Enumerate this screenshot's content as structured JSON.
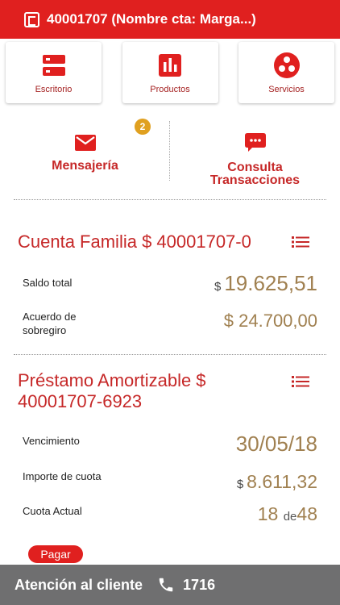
{
  "header": {
    "title": "40001707 (Nombre cta: Marga...)",
    "icon": "bank-logo-icon",
    "bg_color": "#e0201f"
  },
  "tiles": [
    {
      "label": "Escritorio",
      "icon": "desktop-icon"
    },
    {
      "label": "Productos",
      "icon": "bar-chart-icon"
    },
    {
      "label": "Servicios",
      "icon": "services-icon"
    }
  ],
  "shortcuts": {
    "messaging": {
      "label": "Mensajería",
      "icon": "envelope-icon",
      "badge": "2"
    },
    "transactions": {
      "label": "Consulta Transacciones",
      "icon": "chat-bubble-icon"
    }
  },
  "account": {
    "title": "Cuenta Familia $ 40001707-0",
    "menu_icon": "list-menu-icon",
    "rows": [
      {
        "label": "Saldo total",
        "currency": "$",
        "amount": "19.625,51"
      },
      {
        "label": "Acuerdo de sobregiro",
        "currency": "$",
        "amount": "24.700,00"
      }
    ]
  },
  "loan": {
    "title": "Préstamo Amortizable $ 40001707-6923",
    "menu_icon": "list-menu-icon",
    "rows": [
      {
        "label": "Vencimiento",
        "value": "30/05/18"
      },
      {
        "label": "Importe de cuota",
        "currency": "$",
        "amount": "8.611,32"
      },
      {
        "label": "Cuota Actual",
        "current": "18",
        "connector": "de",
        "total": "48"
      }
    ],
    "pay_label": "Pagar"
  },
  "footer": {
    "label": "Atención al cliente",
    "icon": "phone-icon",
    "phone": "1716",
    "bg_color": "#6f6f70"
  }
}
